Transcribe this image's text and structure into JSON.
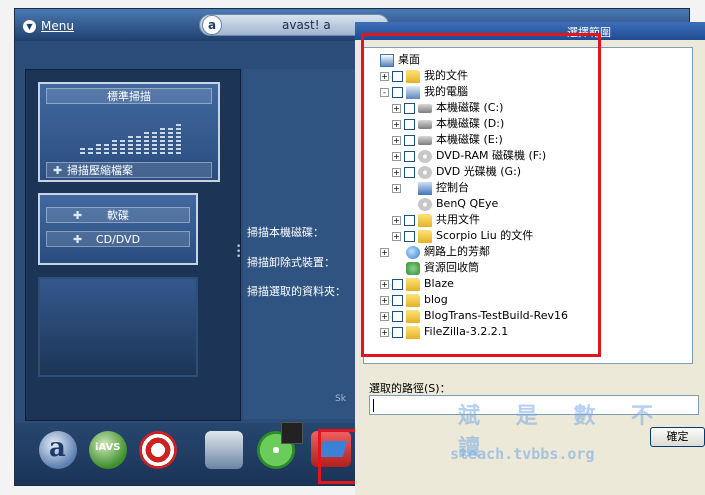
{
  "avast": {
    "menu_label": "Menu",
    "title": "avast! a",
    "scan_panel": {
      "standard_scan": "標準掃描",
      "compressed_files": "掃描壓縮檔案",
      "floppy": "軟碟",
      "cd_dvd": "CD/DVD"
    },
    "scan_options": [
      "掃描本機磁碟：",
      "掃描卸除式裝置：",
      "掃描選取的資料夾："
    ],
    "sk_text": "Sk",
    "toolbar_icons": [
      "avast-icon",
      "iavs-update-icon",
      "lifebuoy-icon",
      "hard-disk-icon",
      "cd-icon",
      "floppy-icon",
      "folder-icon"
    ],
    "iavs_label": "iAVS"
  },
  "dialog": {
    "title": "選擇範圍",
    "tree": [
      {
        "label": "桌面",
        "icon": "desktop-icon",
        "level": 0,
        "expander": "",
        "checkbox": false
      },
      {
        "label": "我的文件",
        "icon": "folder-icon",
        "level": 1,
        "expander": "+",
        "checkbox": true
      },
      {
        "label": "我的電腦",
        "icon": "computer-icon",
        "level": 1,
        "expander": "-",
        "checkbox": true
      },
      {
        "label": "本機磁碟 (C:)",
        "icon": "drive-icon",
        "level": 2,
        "expander": "+",
        "checkbox": true
      },
      {
        "label": "本機磁碟 (D:)",
        "icon": "drive-icon",
        "level": 2,
        "expander": "+",
        "checkbox": true
      },
      {
        "label": "本機磁碟 (E:)",
        "icon": "drive-icon",
        "level": 2,
        "expander": "+",
        "checkbox": true
      },
      {
        "label": "DVD-RAM 磁碟機 (F:)",
        "icon": "disc-icon",
        "level": 2,
        "expander": "+",
        "checkbox": true
      },
      {
        "label": "DVD 光碟機 (G:)",
        "icon": "disc-icon",
        "level": 2,
        "expander": "+",
        "checkbox": true
      },
      {
        "label": "控制台",
        "icon": "control-panel-icon",
        "level": 2,
        "expander": "+",
        "checkbox": false
      },
      {
        "label": "BenQ QEye",
        "icon": "disc-icon",
        "level": 2,
        "expander": "",
        "checkbox": false
      },
      {
        "label": "共用文件",
        "icon": "folder-icon",
        "level": 2,
        "expander": "+",
        "checkbox": true
      },
      {
        "label": "Scorpio Liu 的文件",
        "icon": "folder-icon",
        "level": 2,
        "expander": "+",
        "checkbox": true
      },
      {
        "label": "網路上的芳鄰",
        "icon": "network-icon",
        "level": 1,
        "expander": "+",
        "checkbox": false
      },
      {
        "label": "資源回收筒",
        "icon": "recycle-bin-icon",
        "level": 1,
        "expander": "",
        "checkbox": false
      },
      {
        "label": "Blaze",
        "icon": "folder-icon",
        "level": 1,
        "expander": "+",
        "checkbox": true
      },
      {
        "label": "blog",
        "icon": "folder-icon",
        "level": 1,
        "expander": "+",
        "checkbox": true
      },
      {
        "label": "BlogTrans-TestBuild-Rev16",
        "icon": "folder-icon",
        "level": 1,
        "expander": "+",
        "checkbox": true
      },
      {
        "label": "FileZilla-3.2.2.1",
        "icon": "folder-icon",
        "level": 1,
        "expander": "+",
        "checkbox": true
      }
    ],
    "path_label": "選取的路徑(S)：",
    "path_value": "",
    "ok_label": "確定"
  },
  "watermark": {
    "line1": "斌 是 數 不 讀",
    "line2": "steach.tvbbs.org"
  },
  "colors": {
    "highlight": "#e2141c",
    "avast_blue": "#2c4d7a",
    "dialog_bg": "#ece9d8"
  }
}
